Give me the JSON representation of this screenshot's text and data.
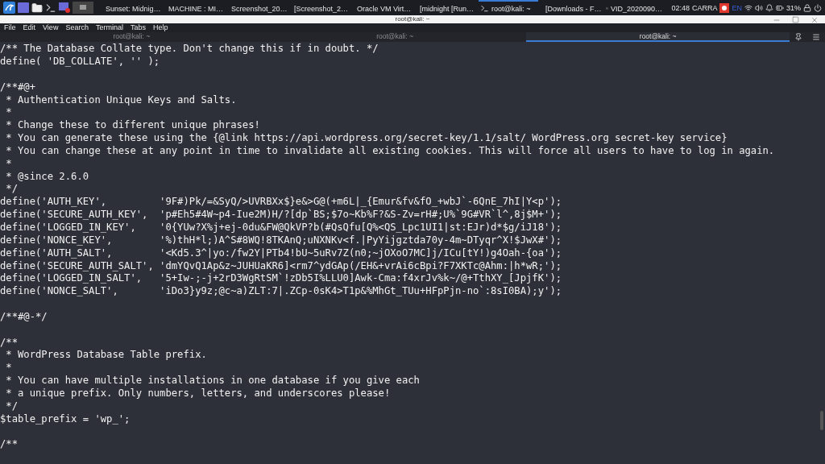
{
  "taskbar": {
    "tasks": [
      {
        "kind": "browser",
        "label": "Sunset: Midnig…",
        "selected": false
      },
      {
        "kind": "browser",
        "label": "MACHINE : MI…",
        "selected": false
      },
      {
        "kind": "image",
        "label": "Screenshot_20…",
        "selected": false
      },
      {
        "kind": "image",
        "label": "[Screenshot_2…",
        "selected": false
      },
      {
        "kind": "vm",
        "label": "Oracle VM Virt…",
        "selected": false
      },
      {
        "kind": "vm",
        "label": "[midnight [Run…",
        "selected": false
      },
      {
        "kind": "terminal",
        "label": "root@kali: ~",
        "selected": true
      },
      {
        "kind": "folder",
        "label": "[Downloads - F…",
        "selected": false
      },
      {
        "kind": "video",
        "label": "VID_2020090…",
        "selected": false
      }
    ],
    "clock": "02:48",
    "user": "CARRA",
    "keyboard": "EN",
    "battery": "31%"
  },
  "window": {
    "title": "root@kali: ~"
  },
  "menu": [
    "File",
    "Edit",
    "View",
    "Search",
    "Terminal",
    "Tabs",
    "Help"
  ],
  "tabs": [
    {
      "label": "root@kali: ~",
      "selected": false
    },
    {
      "label": "root@kali: ~",
      "selected": false
    },
    {
      "label": "root@kali: ~",
      "selected": true
    }
  ],
  "terminal": {
    "blocks": [
      [
        "/** The Database Collate type. Don't change this if in doubt. */",
        "define( 'DB_COLLATE', '' );"
      ],
      [
        "/**#@+",
        " * Authentication Unique Keys and Salts.",
        " *",
        " * Change these to different unique phrases!",
        " * You can generate these using the {@link https://api.wordpress.org/secret-key/1.1/salt/ WordPress.org secret-key service}",
        " * You can change these at any point in time to invalidate all existing cookies. This will force all users to have to log in again.",
        " *",
        " * @since 2.6.0",
        " */",
        "define('AUTH_KEY',         '9F#)Pk/=&SyQ/>UVRBXx$}e&>G@(+m6L|_{Emur&fv&fO_+wbJ`-6QnE_7hI|Y<p');",
        "define('SECURE_AUTH_KEY',  'p#Eh5#4W~p4-Iue2M)H/?[dp`BS;$7o~Kb%F?&S-Zv=rH#;U%`9G#VR`l^,8j$M+');",
        "define('LOGGED_IN_KEY',    '0{YUw?X%j+ej-0du&FW@QkVP?b(#QsQfu[Q%<QS_Lpc1UI1|st:EJr)d*$g/iJ18');",
        "define('NONCE_KEY',        '%)thH*l;)A^S#8WQ!8TKAnQ;uNXNKv<f.|PyYijgztda70y-4m~DTyqr^X!$JwX#');",
        "define('AUTH_SALT',        '<Kd5.3^|yo:/fw2Y|PTb4!bU~5uRv7Z(n0;~jOXoO7MC]j/ICu[tY!)g4Oah-{oa');",
        "define('SECURE_AUTH_SALT', 'dmYQvQ1Ap&z~JUHUaKR6]<rm7^ydGAp(/EH&+vrAi6cBpi?F7XKTc@Ahm:|h*wR;');",
        "define('LOGGED_IN_SALT',   '5+Iw-;-j+2rD3WgRtSM`!zDb5I%LLU0]Awk-Cma:f4xrJv%k~/@+TthXY_[JpjfK');",
        "define('NONCE_SALT',       'iDo3}y9z;@c~a)ZLT:7|.ZCp-0sK4>T1p&%MhGt_TUu+HFpPjn-no`:8sI0BA);y');"
      ],
      [
        "/**#@-*/"
      ],
      [
        "/**",
        " * WordPress Database Table prefix.",
        " *",
        " * You can have multiple installations in one database if you give each",
        " * a unique prefix. Only numbers, letters, and underscores please!",
        " */",
        "$table_prefix = 'wp_';"
      ],
      [
        "/**"
      ]
    ]
  }
}
